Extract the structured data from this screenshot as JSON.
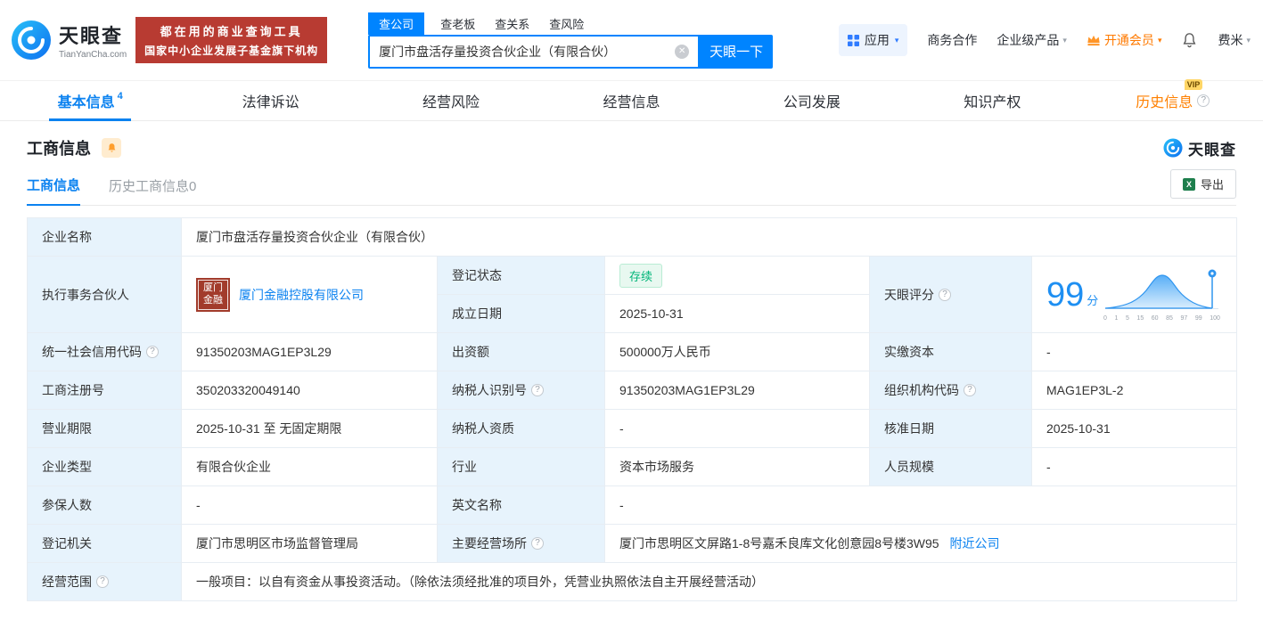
{
  "icons": {
    "help": "?",
    "clear": "✕",
    "caret": "▾"
  },
  "colors": {
    "accent_blue": "#0084ff",
    "vip_orange": "#ff7a00",
    "status_green": "#00b578",
    "label_bg": "#e7f3fc",
    "banner_red": "#b83b32"
  },
  "header": {
    "logo_title": "天眼查",
    "logo_domain": "TianYanCha.com",
    "banner_line1": "都在用的商业查询工具",
    "banner_line2": "国家中小企业发展子基金旗下机构",
    "search_tabs": [
      {
        "label": "查公司",
        "active": true
      },
      {
        "label": "查老板",
        "active": false
      },
      {
        "label": "查关系",
        "active": false
      },
      {
        "label": "查风险",
        "active": false
      }
    ],
    "search_value": "厦门市盘活存量投资合伙企业（有限合伙）",
    "search_button": "天眼一下",
    "menu": {
      "apps": "应用",
      "cooperation": "商务合作",
      "enterprise": "企业级产品",
      "vip": "开通会员",
      "user": "费米"
    }
  },
  "nav": {
    "vip_badge": "VIP",
    "tabs": [
      {
        "label": "基本信息",
        "count": "4",
        "active": true
      },
      {
        "label": "法律诉讼",
        "active": false
      },
      {
        "label": "经营风险",
        "active": false
      },
      {
        "label": "经营信息",
        "active": false
      },
      {
        "label": "公司发展",
        "active": false
      },
      {
        "label": "知识产权",
        "active": false
      },
      {
        "label": "历史信息",
        "active": false,
        "vip": true
      }
    ]
  },
  "section": {
    "title": "工商信息",
    "watermark": "天眼查",
    "sub_tabs": [
      {
        "label": "工商信息",
        "active": true
      },
      {
        "label": "历史工商信息0",
        "active": false
      }
    ],
    "export_label": "导出"
  },
  "score": {
    "label": "天眼评分",
    "value": "99",
    "unit": "分",
    "axis": [
      "0",
      "1",
      "5",
      "15",
      "60",
      "85",
      "97",
      "99",
      "100"
    ]
  },
  "table": {
    "company_name_label": "企业名称",
    "company_name": "厦门市盘活存量投资合伙企业（有限合伙）",
    "partner_label": "执行事务合伙人",
    "partner_logo_line1": "厦门",
    "partner_logo_line2": "金融",
    "partner_name": "厦门金融控股有限公司",
    "status_label": "登记状态",
    "status_value": "存续",
    "established_label": "成立日期",
    "established_value": "2025-10-31",
    "uscc_label": "统一社会信用代码",
    "uscc_value": "91350203MAG1EP3L29",
    "capital_label": "出资额",
    "capital_value": "500000万人民币",
    "paidin_label": "实缴资本",
    "paidin_value": "-",
    "regno_label": "工商注册号",
    "regno_value": "350203320049140",
    "taxid_label": "纳税人识别号",
    "taxid_value": "91350203MAG1EP3L29",
    "orgcode_label": "组织机构代码",
    "orgcode_value": "MAG1EP3L-2",
    "term_label": "营业期限",
    "term_value": "2025-10-31 至 无固定期限",
    "taxquality_label": "纳税人资质",
    "taxquality_value": "-",
    "approval_label": "核准日期",
    "approval_value": "2025-10-31",
    "type_label": "企业类型",
    "type_value": "有限合伙企业",
    "industry_label": "行业",
    "industry_value": "资本市场服务",
    "staff_label": "人员规模",
    "staff_value": "-",
    "insured_label": "参保人数",
    "insured_value": "-",
    "english_label": "英文名称",
    "english_value": "-",
    "authority_label": "登记机关",
    "authority_value": "厦门市思明区市场监督管理局",
    "address_label": "主要经营场所",
    "address_value": "厦门市思明区文屏路1-8号嘉禾良库文化创意园8号楼3W95",
    "nearby_link": "附近公司",
    "scope_label": "经营范围",
    "scope_value": "一般项目：以自有资金从事投资活动。（除依法须经批准的项目外，凭营业执照依法自主开展经营活动）"
  }
}
